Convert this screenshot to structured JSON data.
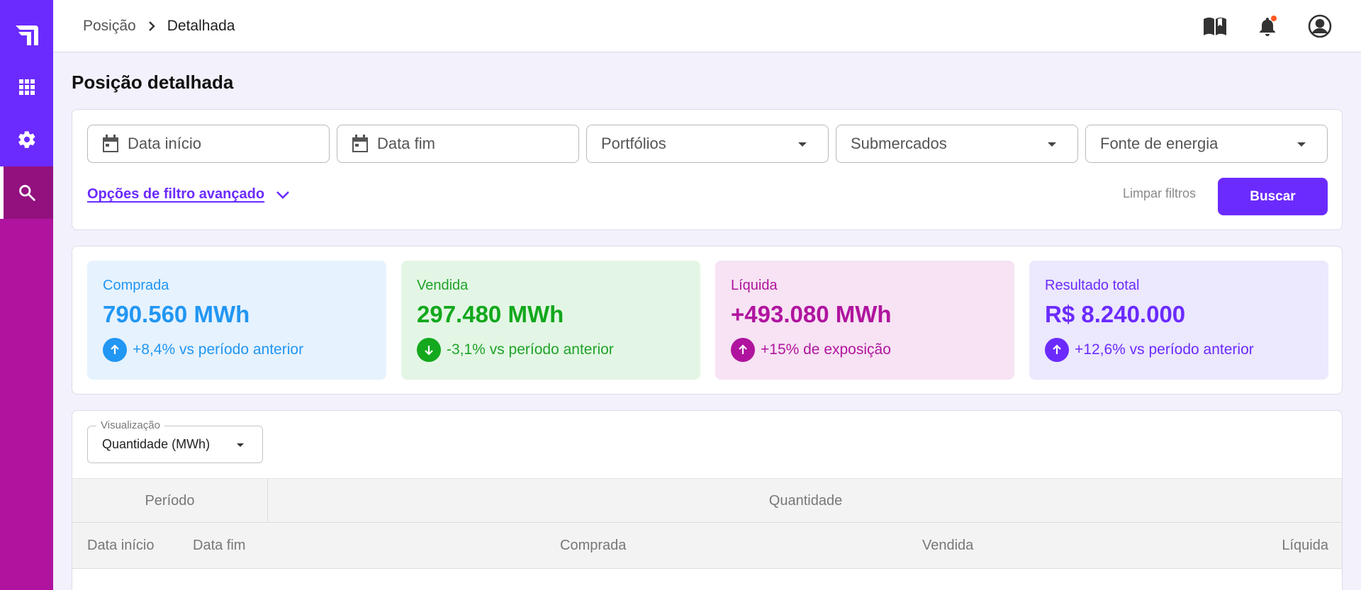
{
  "breadcrumb": {
    "parent": "Posição",
    "current": "Detalhada"
  },
  "page": {
    "title": "Posição detalhada"
  },
  "filters": {
    "date_start_placeholder": "Data início",
    "date_end_placeholder": "Data fim",
    "portfolios": "Portfólios",
    "submarkets": "Submercados",
    "energy_source": "Fonte de energia",
    "advanced_label": "Opções de filtro avançado",
    "clear_label": "Limpar filtros",
    "search_label": "Buscar"
  },
  "kpis": [
    {
      "label": "Comprada",
      "value": "790.560 MWh",
      "delta": "+8,4% vs período anterior",
      "direction": "up",
      "color": "#2196f3"
    },
    {
      "label": "Vendida",
      "value": "297.480 MWh",
      "delta": "-3,1% vs período anterior",
      "direction": "down",
      "color": "#12a81c"
    },
    {
      "label": "Líquida",
      "value": "+493.080 MWh",
      "delta": "+15% de exposição",
      "direction": "up",
      "color": "#b0149f"
    },
    {
      "label": "Resultado total",
      "value": "R$ 8.240.000",
      "delta": "+12,6% vs período anterior",
      "direction": "up",
      "color": "#6b2bff"
    }
  ],
  "table": {
    "visualization_label": "Visualização",
    "visualization_value": "Quantidade (MWh)",
    "group_headers": [
      "Período",
      "Quantidade"
    ],
    "columns": [
      "Data início",
      "Data fim",
      "Comprada",
      "Vendida",
      "Líquida"
    ]
  },
  "icons": {
    "sidebar": [
      "logo-icon",
      "apps-grid-icon",
      "gear-icon",
      "search-icon"
    ],
    "topbar": [
      "book-icon",
      "bell-icon",
      "user-circle-icon"
    ]
  },
  "colors": {
    "primary": "#6b2bff",
    "magenta": "#b0149f"
  }
}
